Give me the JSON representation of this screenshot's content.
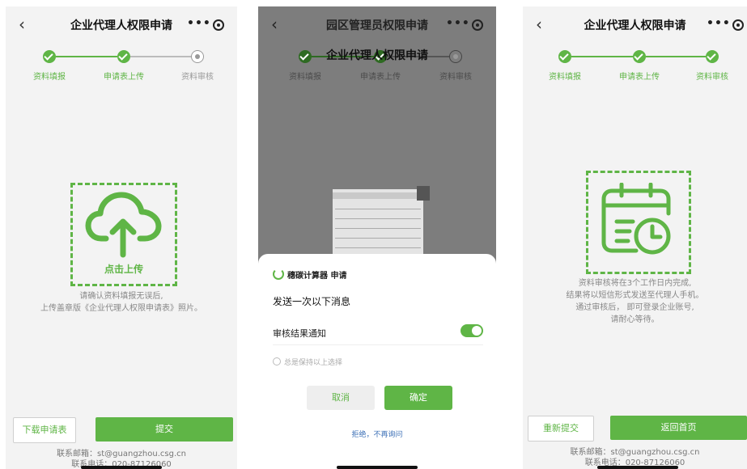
{
  "screens": [
    {
      "title": "企业代理人权限申请",
      "steps": [
        {
          "label": "资料填报",
          "state": "done"
        },
        {
          "label": "申请表上传",
          "state": "done"
        },
        {
          "label": "资料审核",
          "state": "pending"
        }
      ],
      "upload_label": "点击上传",
      "hint_lines": [
        "请确认资料填报无误后,",
        "上传盖章版《企业代理人权限申请表》照片。"
      ],
      "buttons": {
        "download": "下载申请表",
        "submit": "提交"
      },
      "contact": {
        "email": "联系邮箱：st@guangzhou.csg.cn",
        "phone": "联系电话：020-87126060"
      }
    },
    {
      "title": "园区管理员权限申请",
      "underlay_title": "企业代理人权限申请",
      "steps": [
        {
          "label": "资料填报"
        },
        {
          "label": "申请表上传"
        },
        {
          "label": "资料审核"
        }
      ],
      "sheet": {
        "app_name": "穗碳计算器 申请",
        "title": "发送一次以下消息",
        "item": "审核结果通知",
        "toggle_on": true,
        "remember": "总是保持以上选择",
        "cancel": "取消",
        "confirm": "确定",
        "refuse": "拒绝，不再询问"
      }
    },
    {
      "title": "企业代理人权限申请",
      "steps": [
        {
          "label": "资料填报",
          "state": "done"
        },
        {
          "label": "申请表上传",
          "state": "done"
        },
        {
          "label": "资料审核",
          "state": "done"
        }
      ],
      "notice_lines": [
        "资料审核将在3个工作日内完成,",
        "结果将以短信形式发送至代理人手机。",
        "通过审核后， 即可登录企业账号,",
        "请耐心等待。"
      ],
      "buttons": {
        "resubmit": "重新提交",
        "home": "返回首页"
      },
      "contact": {
        "email": "联系邮箱：st@guangzhou.csg.cn",
        "phone": "联系电话：020-87126060"
      }
    }
  ],
  "colors": {
    "accent": "#5fb546",
    "link": "#3b6fb6",
    "overlay": "#7d7d7d"
  },
  "icons": [
    "back-icon",
    "more-icon",
    "target-icon",
    "check-icon",
    "upload-cloud-icon",
    "calendar-clock-icon",
    "app-logo-icon"
  ]
}
